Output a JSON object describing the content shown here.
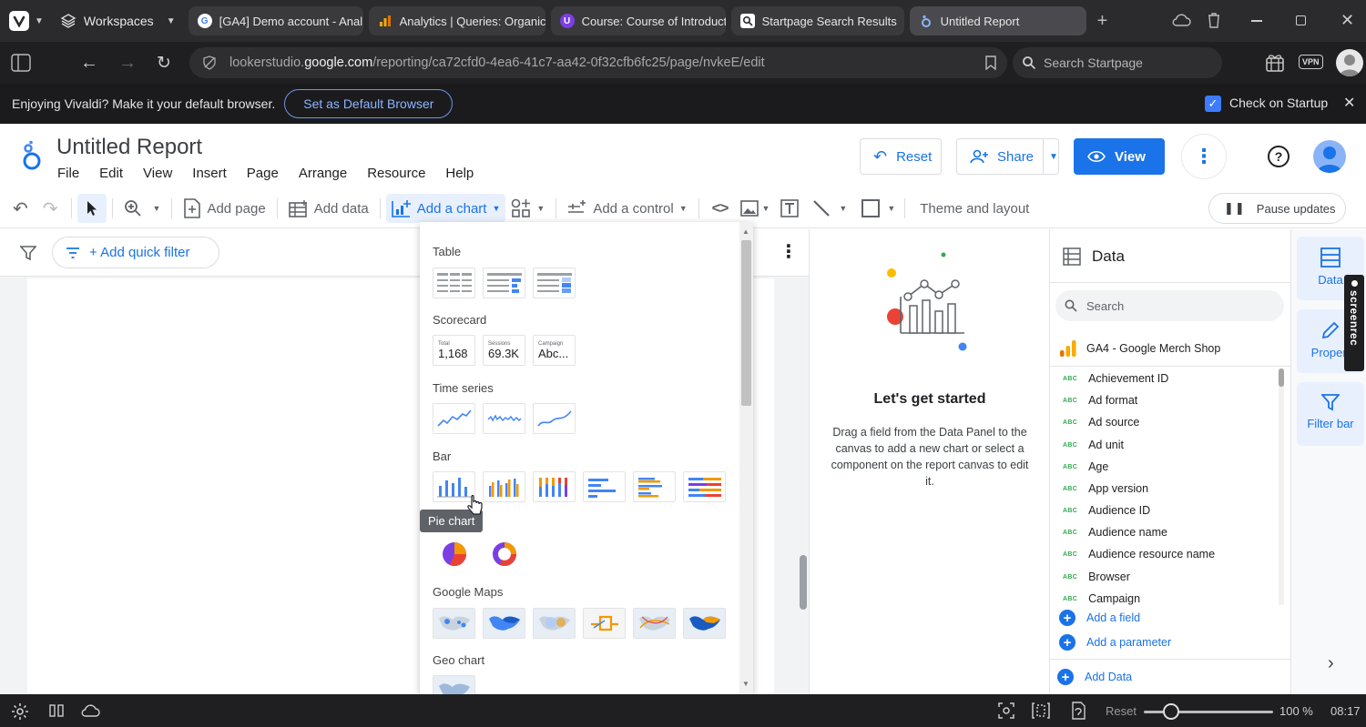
{
  "browser": {
    "workspaces_label": "Workspaces",
    "tabs": [
      {
        "label": "[GA4] Demo account - Anal"
      },
      {
        "label": "Analytics | Queries: Organic"
      },
      {
        "label": "Course: Course of Introducti"
      },
      {
        "label": "Startpage Search Results"
      },
      {
        "label": "Untitled Report"
      }
    ],
    "url_prefix": "lookerstudio.",
    "url_domain": "google.com",
    "url_path": "/reporting/ca72cfd0-4ea6-41c7-aa42-0f32cfb6fc25/page/nvkeE/edit",
    "search_placeholder": "Search Startpage",
    "vpn_label": "VPN",
    "notification_text": "Enjoying Vivaldi? Make it your default browser.",
    "default_button": "Set as Default Browser",
    "check_startup": "Check on Startup"
  },
  "app": {
    "title": "Untitled Report",
    "menu": [
      "File",
      "Edit",
      "View",
      "Insert",
      "Page",
      "Arrange",
      "Resource",
      "Help"
    ],
    "reset_label": "Reset",
    "share_label": "Share",
    "view_label": "View"
  },
  "toolbar": {
    "add_page": "Add page",
    "add_data": "Add data",
    "add_chart": "Add a chart",
    "add_control": "Add a control",
    "theme_layout": "Theme and layout",
    "pause_updates": "Pause updates"
  },
  "filter": {
    "add_quick_filter": "+ Add quick filter"
  },
  "chart_menu": {
    "sections": {
      "table": "Table",
      "scorecard": "Scorecard",
      "time_series": "Time series",
      "bar": "Bar",
      "google_maps": "Google Maps",
      "geo_chart": "Geo chart"
    },
    "scorecards": [
      {
        "label": "Total",
        "value": "1,168"
      },
      {
        "label": "Sessions",
        "value": "69.3K"
      },
      {
        "label": "Campaign",
        "value": "Abc..."
      }
    ],
    "tooltip": "Pie chart"
  },
  "get_started": {
    "title": "Let's get started",
    "body": "Drag a field from the Data Panel to the canvas to add a new chart or select a component on the report canvas to edit it."
  },
  "data_panel": {
    "title": "Data",
    "search_placeholder": "Search",
    "source": "GA4 - Google Merch Shop",
    "field_type": "ABC",
    "fields": [
      "Achievement ID",
      "Ad format",
      "Ad source",
      "Ad unit",
      "Age",
      "App version",
      "Audience ID",
      "Audience name",
      "Audience resource name",
      "Browser",
      "Campaign"
    ],
    "add_field": "Add a field",
    "add_parameter": "Add a parameter",
    "add_data": "Add Data"
  },
  "rail": {
    "data": "Data",
    "properties": "Propert",
    "filter_bar": "Filter bar"
  },
  "recorder": {
    "label": "screenrec"
  },
  "status": {
    "reset": "Reset",
    "zoom": "100 %",
    "time": "08:17"
  },
  "colors": {
    "accent": "#1a73e8",
    "chrome_dark": "#2b2b2d"
  }
}
